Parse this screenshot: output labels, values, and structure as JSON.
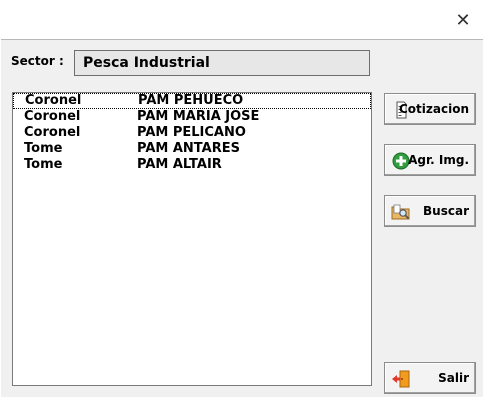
{
  "window": {
    "close_glyph": "✕"
  },
  "sector": {
    "label": "Sector :",
    "value": "Pesca Industrial"
  },
  "list": {
    "rows": [
      {
        "location": "Coronel",
        "vessel": "PAM PEHUECO"
      },
      {
        "location": "Coronel",
        "vessel": "PAM MARIA JOSE"
      },
      {
        "location": "Coronel",
        "vessel": "PAM PELICANO"
      },
      {
        "location": "Tome",
        "vessel": "PAM ANTARES"
      },
      {
        "location": "Tome",
        "vessel": "PAM ALTAIR"
      }
    ]
  },
  "buttons": {
    "cotizacion": {
      "label": "Cotizacion",
      "icon": "document-icon"
    },
    "agr_img": {
      "label": "Agr. Img.",
      "icon": "add-plus-icon"
    },
    "buscar": {
      "label": "Buscar",
      "icon": "folder-search-icon"
    },
    "salir": {
      "label": "Salir",
      "icon": "exit-door-icon"
    }
  },
  "colors": {
    "client_bg": "#f0f0f0",
    "add_icon_green": "#2e9e3e",
    "exit_red": "#e2382b",
    "door_orange": "#f29c1f"
  }
}
